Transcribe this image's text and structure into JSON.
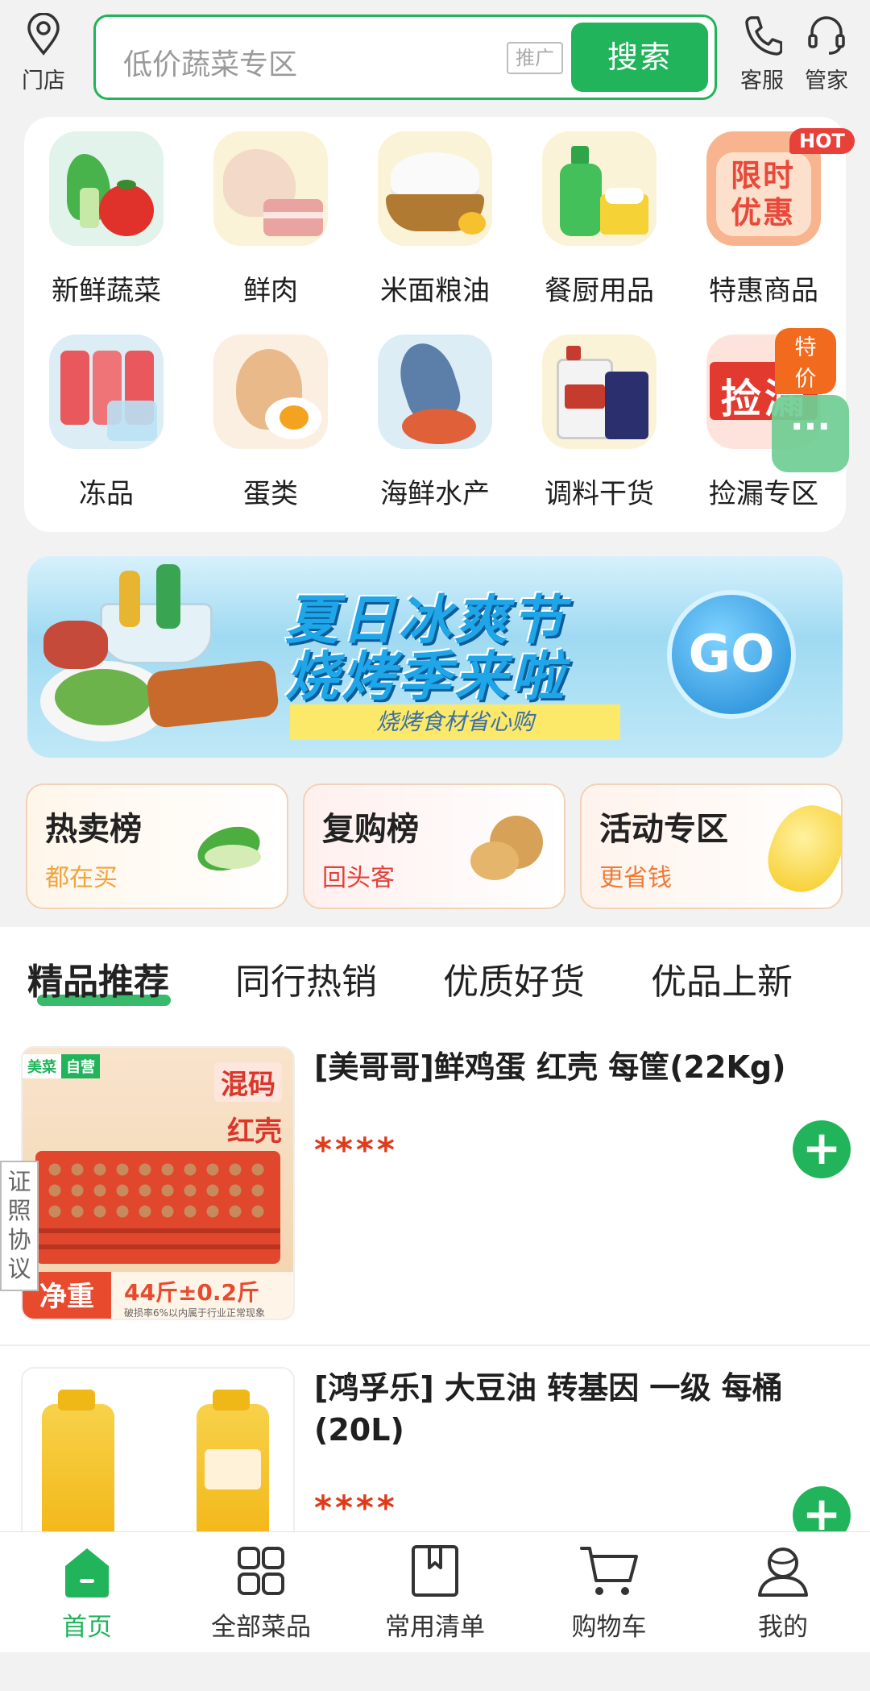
{
  "header": {
    "store_label": "门店",
    "search_placeholder": "低价蔬菜专区",
    "ad_tag": "推广",
    "search_button": "搜索",
    "service_label": "客服",
    "manager_label": "管家"
  },
  "categories": [
    {
      "label": "新鲜蔬菜",
      "icon": "vegetables-icon"
    },
    {
      "label": "鲜肉",
      "icon": "meat-icon"
    },
    {
      "label": "米面粮油",
      "icon": "rice-icon"
    },
    {
      "label": "餐厨用品",
      "icon": "kitchen-supplies-icon"
    },
    {
      "label": "特惠商品",
      "icon": "special-offer-icon",
      "badge": "HOT",
      "image_text": "限时优惠"
    },
    {
      "label": "冻品",
      "icon": "frozen-food-icon"
    },
    {
      "label": "蛋类",
      "icon": "egg-icon"
    },
    {
      "label": "海鲜水产",
      "icon": "seafood-icon"
    },
    {
      "label": "调料干货",
      "icon": "seasoning-icon"
    },
    {
      "label": "捡漏专区",
      "icon": "bargain-icon",
      "badge": "特价",
      "image_text": "捡漏"
    }
  ],
  "banner": {
    "line1": "夏日冰爽节",
    "line2": "烧烤季来啦",
    "subtitle": "烧烤食材省心购",
    "go": "GO"
  },
  "rank_cards": [
    {
      "title": "热卖榜",
      "subtitle": "都在买",
      "subtitle_color": "#f0a33c"
    },
    {
      "title": "复购榜",
      "subtitle": "回头客",
      "subtitle_color": "#e2413a"
    },
    {
      "title": "活动专区",
      "subtitle": "更省钱",
      "subtitle_color": "#f07a35"
    }
  ],
  "tabs": [
    "精品推荐",
    "同行热销",
    "优质好货",
    "优品上新"
  ],
  "products": [
    {
      "name": "[美哥哥]鲜鸡蛋 红壳 每筐(22Kg)",
      "price": "****",
      "img_tag1": "美菜",
      "img_tag2": "自营",
      "img_text1": "混码",
      "img_text2": "红壳",
      "img_weight": "净重",
      "img_weight_value": "44斤±0.2斤",
      "img_note": "破损率6%以内属于行业正常现象"
    },
    {
      "name": "[鸿孚乐] 大豆油 转基因 一级 每桶(20L)",
      "price": "****"
    }
  ],
  "side_tag": "证照协议",
  "bottom_nav": [
    {
      "label": "首页",
      "icon": "home-icon",
      "active": true
    },
    {
      "label": "全部菜品",
      "icon": "grid-icon",
      "active": false
    },
    {
      "label": "常用清单",
      "icon": "bookmark-icon",
      "active": false
    },
    {
      "label": "购物车",
      "icon": "cart-icon",
      "active": false
    },
    {
      "label": "我的",
      "icon": "user-icon",
      "active": false
    }
  ],
  "colors": {
    "brand_green": "#21b45a",
    "price_red": "#e03a1a"
  }
}
